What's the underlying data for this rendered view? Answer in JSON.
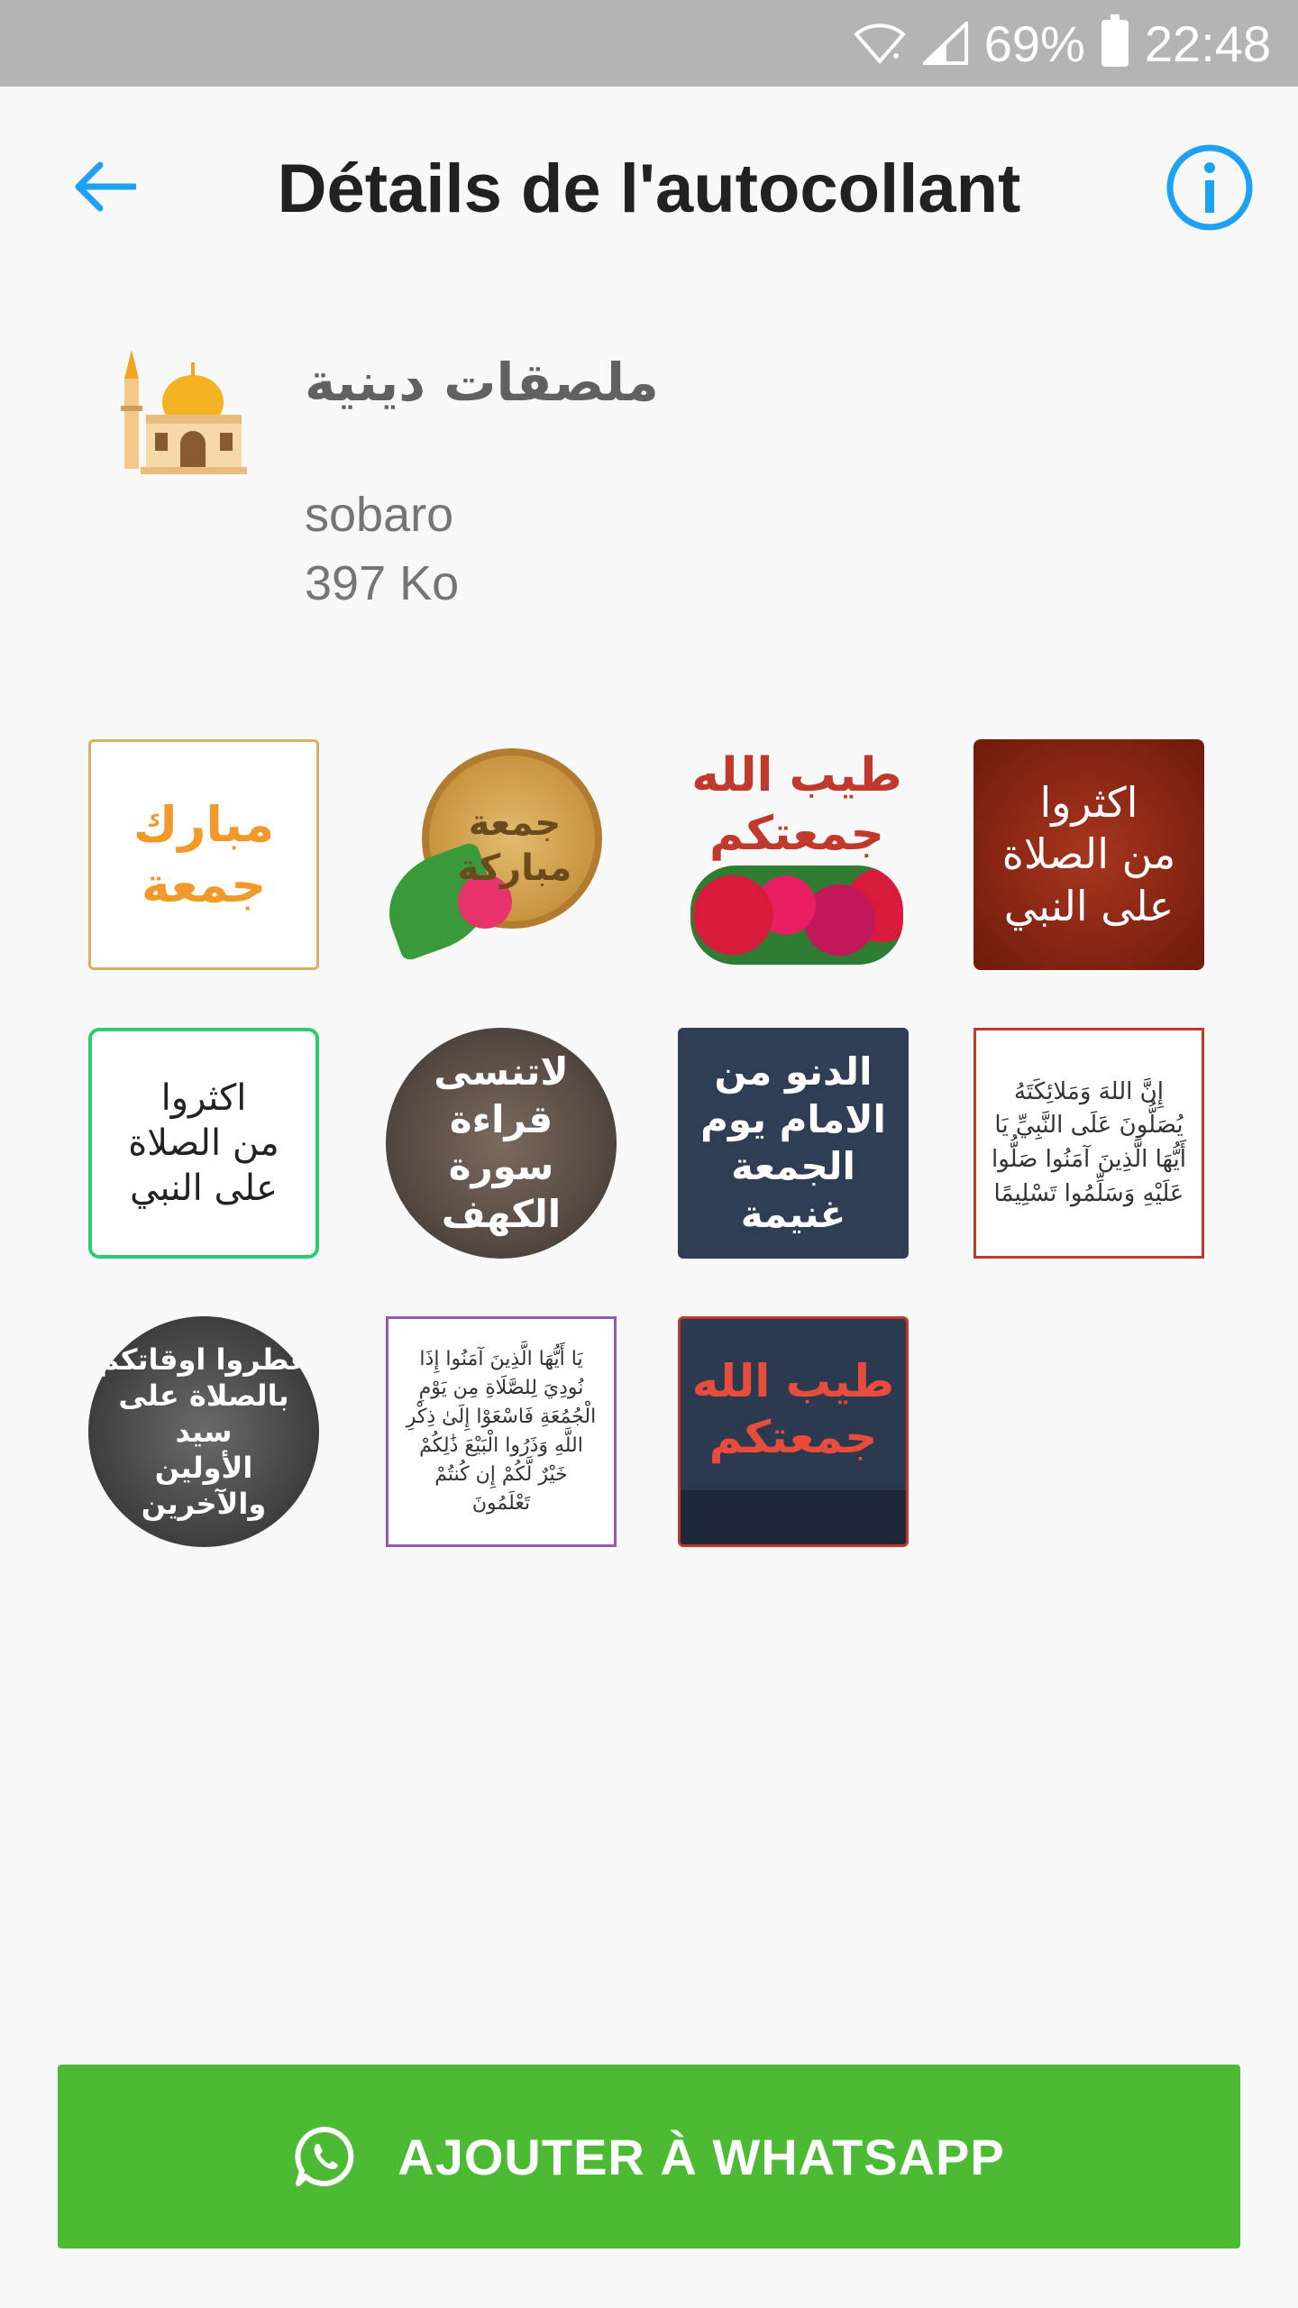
{
  "status_bar": {
    "battery": "69%",
    "time": "22:48",
    "icons": [
      "wifi-icon",
      "signal-icon",
      "battery-icon"
    ]
  },
  "app_bar": {
    "title": "Détails de l'autocollant",
    "back_icon": "arrow-left-icon",
    "info_icon": "info-icon"
  },
  "pack": {
    "name": "ملصقات دينية",
    "publisher": "sobaro",
    "size": "397 Ko",
    "icon": "mosque-icon"
  },
  "stickers": [
    {
      "text": "مبارك\nجمعة"
    },
    {
      "text": "جمعة\nمباركة"
    },
    {
      "text": "طيب الله\nجمعتكم"
    },
    {
      "text": "اكثروا\nمن الصلاة\nعلى النبي"
    },
    {
      "text": "اكثروا\nمن الصلاة\nعلى النبي"
    },
    {
      "text": "لاتنسى قراءة\nسورة الكهف"
    },
    {
      "text": "الدنو من\nالامام يوم\nالجمعة غنيمة"
    },
    {
      "text": "إِنَّ اللهَ وَمَلائِكَتَهُ\nيُصَلُّونَ عَلَى النَّبِيِّ يَا\nأَيُّهَا الَّذِينَ آمَنُوا صَلُّوا\nعَلَيْهِ وَسَلِّمُوا تَسْلِيمًا"
    },
    {
      "text": "عطروا اوقاتكم\nبالصلاة على سيد\nالأولين والآخرين"
    },
    {
      "text": "يَا أَيُّهَا الَّذِينَ آمَنُوا إِذَا\nنُودِيَ لِلصَّلَاةِ مِن يَوْمِ\nالْجُمُعَةِ فَاسْعَوْا إِلَىٰ ذِكْرِ\nاللَّهِ وَذَرُوا الْبَيْعَ ذَٰلِكُمْ\nخَيْرٌ لَّكُمْ إِن كُنتُمْ\nتَعْلَمُونَ"
    },
    {
      "text": "طيب الله\nجمعتكم"
    }
  ],
  "add_button": {
    "label": "AJOUTER À WHATSAPP",
    "icon": "whatsapp-icon",
    "color": "#4cbb33"
  },
  "colors": {
    "accent": "#1da1f2",
    "background": "#f8f8f8",
    "status_bar": "#b4b4b4"
  }
}
